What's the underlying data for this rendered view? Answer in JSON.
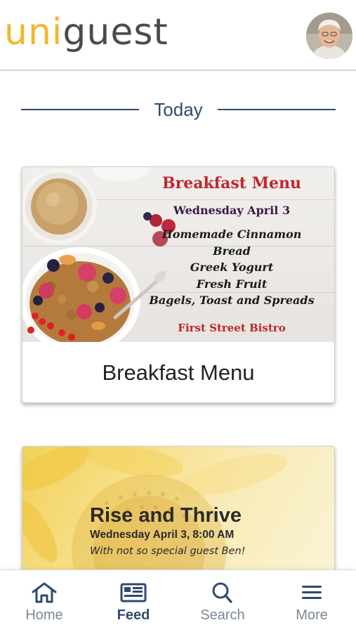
{
  "app": {
    "brand_part1": "uni",
    "brand_part2": "guest"
  },
  "section": {
    "label": "Today"
  },
  "cards": [
    {
      "image_text": {
        "heading": "Breakfast Menu",
        "date": "Wednesday April 3",
        "items": [
          "Homemade Cinnamon",
          "Bread",
          "Greek Yogurt",
          "Fresh Fruit",
          "Bagels, Toast and Spreads"
        ],
        "venue": "First Street Bistro"
      },
      "title": "Breakfast Menu"
    },
    {
      "image_text": {
        "heading": "Rise and Thrive",
        "date": "Wednesday April 3, 8:00 AM",
        "subtitle": "With not so special guest Ben!"
      }
    }
  ],
  "nav": {
    "items": [
      {
        "label": "Home",
        "icon": "home-icon",
        "active": false
      },
      {
        "label": "Feed",
        "icon": "feed-icon",
        "active": true
      },
      {
        "label": "Search",
        "icon": "search-icon",
        "active": false
      },
      {
        "label": "More",
        "icon": "menu-icon",
        "active": false
      }
    ]
  },
  "colors": {
    "brand_yellow": "#f2b72a",
    "brand_gray": "#4b4b4d",
    "accent_navy": "#2f4a6b",
    "inactive_gray": "#7a8796",
    "menu_red": "#c0262d"
  }
}
